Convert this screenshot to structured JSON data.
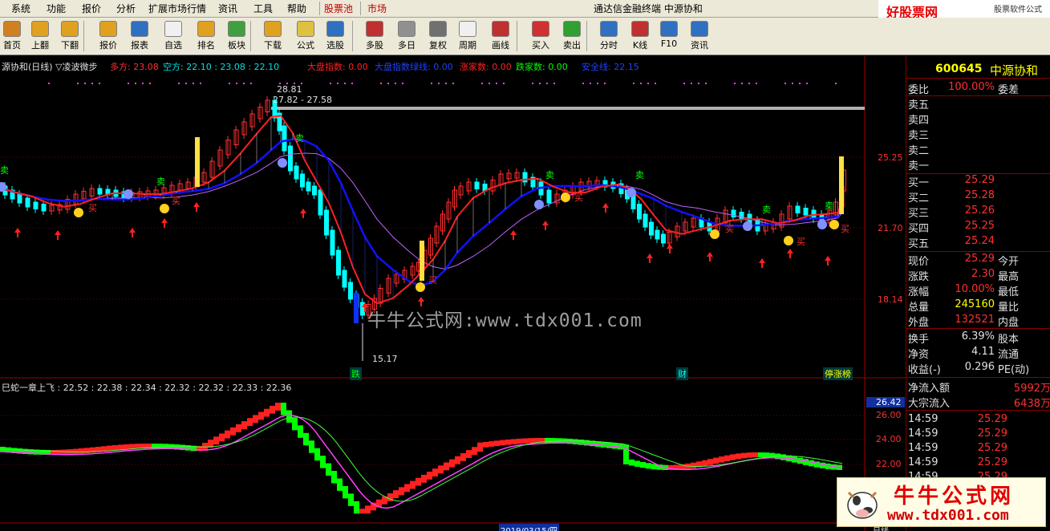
{
  "menu": {
    "items": [
      "系统",
      "功能",
      "报价",
      "分析",
      "扩展市场行情",
      "资讯",
      "工具",
      "帮助",
      "股票池",
      "市场"
    ],
    "title": "通达信金融终端  中源协和",
    "brand": "好股票网Goodgupiao.com",
    "brand_right": "股票软件公式"
  },
  "toolbar": {
    "items": [
      {
        "label": "首页",
        "icon": "home-icon",
        "color": "#d08020"
      },
      {
        "label": "上翻",
        "icon": "arrow-up-icon",
        "color": "#e0a020"
      },
      {
        "label": "下翻",
        "icon": "arrow-down-icon",
        "color": "#e0a020"
      },
      {
        "label": "报价",
        "icon": "yuan-icon",
        "color": "#e0a020"
      },
      {
        "label": "报表",
        "icon": "report-icon",
        "color": "#3070c0"
      },
      {
        "label": "自选",
        "icon": "f6-icon",
        "color": "#f0f0f0"
      },
      {
        "label": "排名",
        "icon": "rank-icon",
        "color": "#e0a020"
      },
      {
        "label": "板块",
        "icon": "sector-icon",
        "color": "#40a040"
      },
      {
        "label": "下载",
        "icon": "download-icon",
        "color": "#e0a020"
      },
      {
        "label": "公式",
        "icon": "formula-icon",
        "color": "#e0c040"
      },
      {
        "label": "选股",
        "icon": "select-stock-icon",
        "color": "#3070c0"
      },
      {
        "label": "多股",
        "icon": "multi-stock-icon",
        "color": "#c03030"
      },
      {
        "label": "多日",
        "icon": "multi-day-icon",
        "color": "#909090"
      },
      {
        "label": "复权",
        "icon": "adjust-icon",
        "color": "#707070"
      },
      {
        "label": "周期",
        "icon": "f8-icon",
        "color": "#f0f0f0"
      },
      {
        "label": "画线",
        "icon": "draw-line-icon",
        "color": "#c03030"
      },
      {
        "label": "买入",
        "icon": "buy-icon",
        "color": "#d03030"
      },
      {
        "label": "卖出",
        "icon": "sell-icon",
        "color": "#30a030"
      },
      {
        "label": "分时",
        "icon": "intraday-icon",
        "color": "#3070c0"
      },
      {
        "label": "K线",
        "icon": "kline-icon",
        "color": "#c03030"
      },
      {
        "label": "F10",
        "icon": "f10-icon",
        "color": "#3070c0"
      },
      {
        "label": "资讯",
        "icon": "news-icon",
        "color": "#3070c0"
      }
    ]
  },
  "legend": {
    "title": "源协和(日线) ▽凌波微步",
    "duofang": "多方: 23.08",
    "kongfang": "空方: 22.10 : 23.08 : 22.10",
    "dapan": "大盘指数: 0.00",
    "dapanshi": "大盘指数绿线: 0.00",
    "zhangjia": "涨家数: 0.00",
    "diejia": "跌家数: 0.00",
    "anquan": "安全线: 22.15"
  },
  "chart_labels": {
    "high": "28.81",
    "range": "27.82 - 27.58",
    "low": "15.17",
    "y_ticks": [
      "25.25",
      "21.70",
      "18.14"
    ],
    "events": [
      "跌",
      "财",
      "停涨榜"
    ],
    "buy": "买",
    "sell": "卖"
  },
  "sub": {
    "legend": "巳蛇一章上飞 : 22.52 : 22.38 : 22.34 : 22.32 : 22.32 : 22.33 : 22.36",
    "y_ticks": [
      "26.00",
      "24.00",
      "22.00"
    ],
    "cursor_value": "26.42",
    "date": "2019/03/15/四",
    "period": "日线"
  },
  "quote": {
    "code": "600645",
    "name": "中源协和",
    "weibi_label": "委比",
    "weibi": "100.00%",
    "weicha_label": "委差",
    "sells": [
      {
        "label": "卖五",
        "price": ""
      },
      {
        "label": "卖四",
        "price": ""
      },
      {
        "label": "卖三",
        "price": ""
      },
      {
        "label": "卖二",
        "price": ""
      },
      {
        "label": "卖一",
        "price": ""
      }
    ],
    "buys": [
      {
        "label": "买一",
        "price": "25.29"
      },
      {
        "label": "买二",
        "price": "25.28"
      },
      {
        "label": "买三",
        "price": "25.26"
      },
      {
        "label": "买四",
        "price": "25.25"
      },
      {
        "label": "买五",
        "price": "25.24"
      }
    ],
    "stats": [
      {
        "l": "现价",
        "v": "25.29",
        "r": "今开"
      },
      {
        "l": "涨跌",
        "v": "2.30",
        "r": "最高"
      },
      {
        "l": "涨幅",
        "v": "10.00%",
        "r": "最低"
      },
      {
        "l": "总量",
        "v": "245160",
        "r": "量比"
      },
      {
        "l": "外盘",
        "v": "132521",
        "r": "内盘"
      }
    ],
    "stats2": [
      {
        "l": "换手",
        "v": "6.39%",
        "r": "股本"
      },
      {
        "l": "净资",
        "v": "4.11",
        "r": "流通"
      },
      {
        "l": "收益(-)",
        "v": "0.296",
        "r": "PE(动)"
      }
    ],
    "flow": [
      {
        "l": "净流入额",
        "v": "5992万"
      },
      {
        "l": "大宗流入",
        "v": "6438万"
      }
    ],
    "ticks": [
      {
        "t": "14:59",
        "p": "25.29"
      },
      {
        "t": "14:59",
        "p": "25.29"
      },
      {
        "t": "14:59",
        "p": "25.29"
      },
      {
        "t": "14:59",
        "p": "25.29"
      },
      {
        "t": "14:59",
        "p": "25.29"
      }
    ]
  },
  "watermark": {
    "mid": "牛牛公式网:www.tdx001.com",
    "box_title": "牛牛公式网",
    "box_url": "www.tdx001.com"
  },
  "colors": {
    "up": "#ff3030",
    "down": "#00ffff",
    "ma_blue": "#1010ff",
    "ma_red": "#ff2020",
    "green": "#00ff00",
    "purple": "#ff00ff"
  }
}
